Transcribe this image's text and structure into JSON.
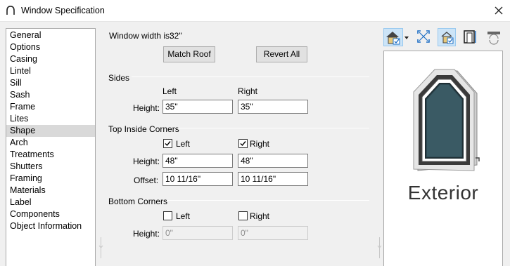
{
  "window": {
    "title": "Window Specification"
  },
  "sidebar": {
    "items": [
      {
        "label": "General"
      },
      {
        "label": "Options"
      },
      {
        "label": "Casing"
      },
      {
        "label": "Lintel"
      },
      {
        "label": "Sill"
      },
      {
        "label": "Sash"
      },
      {
        "label": "Frame"
      },
      {
        "label": "Lites"
      },
      {
        "label": "Shape",
        "selected": true
      },
      {
        "label": "Arch"
      },
      {
        "label": "Treatments"
      },
      {
        "label": "Shutters"
      },
      {
        "label": "Framing"
      },
      {
        "label": "Materials"
      },
      {
        "label": "Label"
      },
      {
        "label": "Components"
      },
      {
        "label": "Object Information"
      }
    ]
  },
  "main": {
    "width_label": "Window width is:",
    "width_value": "32\"",
    "match_roof": "Match Roof",
    "revert_all": "Revert All",
    "sides": {
      "title": "Sides",
      "left_header": "Left",
      "right_header": "Right",
      "height_label": "Height:",
      "left_height": "35\"",
      "right_height": "35\""
    },
    "top_corners": {
      "title": "Top Inside Corners",
      "left_label": "Left",
      "right_label": "Right",
      "left_checked": true,
      "right_checked": true,
      "height_label": "Height:",
      "offset_label": "Offset:",
      "left_height": "48\"",
      "right_height": "48\"",
      "left_offset": "10 11/16\"",
      "right_offset": "10 11/16\""
    },
    "bottom_corners": {
      "title": "Bottom Corners",
      "left_label": "Left",
      "right_label": "Right",
      "left_checked": false,
      "right_checked": false,
      "height_label": "Height:",
      "left_height": "0\"",
      "right_height": "0\""
    }
  },
  "preview": {
    "label": "Exterior",
    "toolbar": [
      "house-view-icon",
      "dropdown-arrow-icon",
      "fill-window-icon",
      "color-toggle-icon",
      "window-frame-icon",
      "swap-view-icon"
    ]
  },
  "colors": {
    "selected_item": "#d9d9d9",
    "accent_blue": "#1e6fc5"
  }
}
